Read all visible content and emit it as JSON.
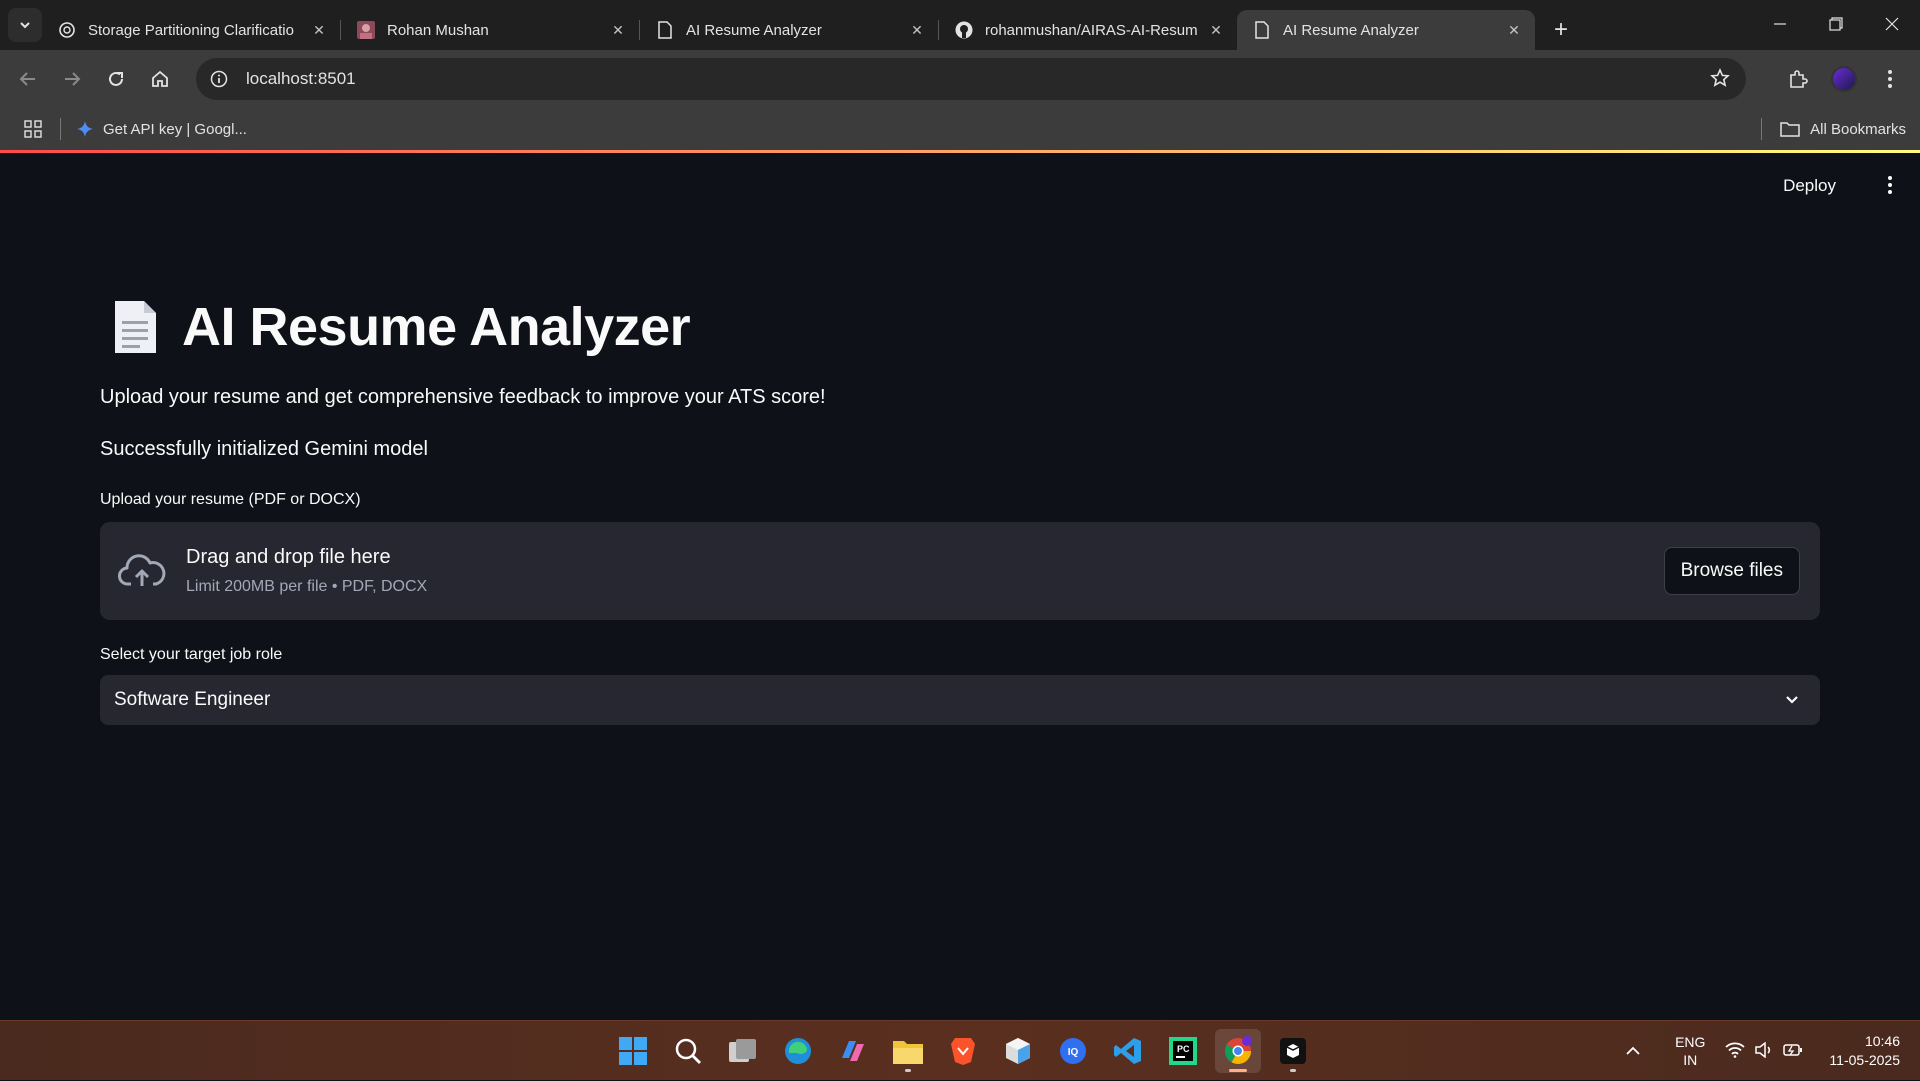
{
  "browser": {
    "tabs": [
      {
        "title": "Storage Partitioning Clarificatio",
        "icon": "openai-icon",
        "active": false
      },
      {
        "title": "Rohan Mushan",
        "icon": "profile-photo-icon",
        "active": false
      },
      {
        "title": "AI Resume Analyzer",
        "icon": "page-icon",
        "active": false
      },
      {
        "title": "rohanmushan/AIRAS-AI-Resum",
        "icon": "github-icon",
        "active": false
      },
      {
        "title": "AI Resume Analyzer",
        "icon": "page-icon",
        "active": true
      }
    ],
    "url": "localhost:8501",
    "bookmarks": [
      {
        "label": "Get API key | Googl...",
        "icon": "google-ai-studio-icon"
      }
    ],
    "all_bookmarks_label": "All Bookmarks"
  },
  "app": {
    "deploy_label": "Deploy",
    "title": "AI Resume Analyzer",
    "subtitle": "Upload your resume and get comprehensive feedback to improve your ATS score!",
    "status": "Successfully initialized Gemini model",
    "upload": {
      "label": "Upload your resume (PDF or DOCX)",
      "drop_text": "Drag and drop file here",
      "limit_text": "Limit 200MB per file • PDF, DOCX",
      "browse_label": "Browse files"
    },
    "role": {
      "label": "Select your target job role",
      "selected": "Software Engineer"
    },
    "colors": {
      "background": "#0e1117",
      "widget": "#262730",
      "accent": "#ff4b4b"
    }
  },
  "taskbar": {
    "apps": [
      "windows-start-icon",
      "search-icon",
      "task-view-icon",
      "edge-icon",
      "copilot-icon",
      "file-explorer-icon",
      "brave-icon",
      "app-cube-icon",
      "intellij-icon",
      "vscode-icon",
      "pycharm-icon",
      "chrome-icon",
      "terminal-app-icon"
    ],
    "lang_1": "ENG",
    "lang_2": "IN",
    "time": "10:46",
    "date": "11-05-2025"
  }
}
